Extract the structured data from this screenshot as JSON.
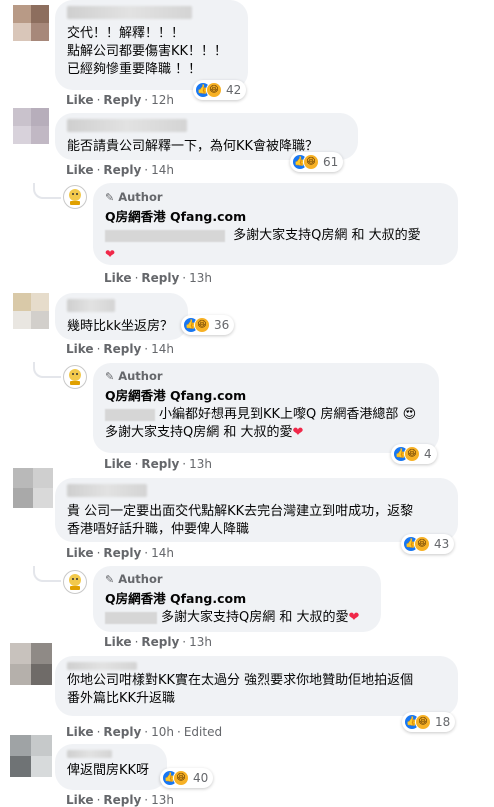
{
  "ui": {
    "like_label": "Like",
    "reply_label": "Reply",
    "dot": "·",
    "author_label": "Author",
    "pen_icon": "✎"
  },
  "comments": [
    {
      "text": "交代！！解釋！！！\n點解公司都要傷害KK！！！\n已經夠慘重要降職 ！！",
      "time": "12h",
      "reactions": [
        "like",
        "haha"
      ],
      "count": "42"
    },
    {
      "text": "能否請貴公司解釋一下，為何KK會被降職？",
      "time": "14h",
      "reactions": [
        "like",
        "haha"
      ],
      "count": "61"
    },
    {
      "is_author": true,
      "page_name": "Q房網香港 Qfang.com",
      "text": "多謝大家支持Q房網 和 大叔的愛",
      "time": "13h"
    },
    {
      "text": "幾時比kk坐返房？",
      "time": "14h",
      "reactions": [
        "like",
        "haha"
      ],
      "count": "36"
    },
    {
      "is_author": true,
      "page_name": "Q房網香港 Qfang.com",
      "line1": "小編都好想再見到KK上嚟Q 房網香港總部",
      "line2": "多謝大家支持Q房網 和 大叔的愛",
      "time": "13h",
      "reactions": [
        "like",
        "haha"
      ],
      "count": "4"
    },
    {
      "text": "貴 公司一定要出面交代點解KK去完台灣建立到咁成功，返黎\n香港唔好話升職，仲要俾人降職",
      "time": "14h",
      "reactions": [
        "like",
        "haha"
      ],
      "count": "43"
    },
    {
      "is_author": true,
      "page_name": "Q房網香港 Qfang.com",
      "text": "多謝大家支持Q房網 和 大叔的愛",
      "time": "13h"
    },
    {
      "text": "你地公司咁樣對KK實在太過分 強烈要求你地贊助佢地拍返個\n番外篇比KK升返職",
      "time": "10h",
      "edited": "Edited",
      "reactions": [
        "like",
        "haha"
      ],
      "count": "18"
    },
    {
      "text": "俾返間房KK呀",
      "time": "13h",
      "reactions": [
        "like",
        "haha"
      ],
      "count": "40"
    }
  ],
  "colors": {
    "like_blue": "#1877f2",
    "haha_yellow": "#f7b125",
    "love_red": "#f33e58",
    "bubble_bg": "#f0f2f5",
    "meta_gray": "#65676b"
  },
  "icons": {
    "like": "like-icon",
    "haha": "haha-icon",
    "love": "love-icon",
    "heart": "heart-icon",
    "heart_eyes": "heart-eyes-icon",
    "pen": "pencil-icon"
  }
}
